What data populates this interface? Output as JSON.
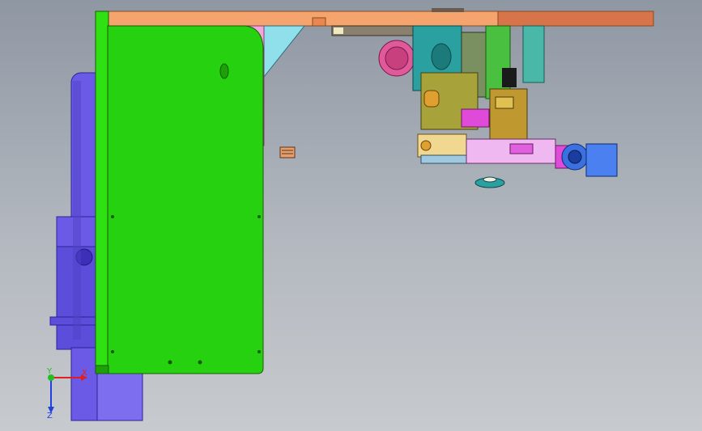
{
  "viewport": {
    "background_top": "#8f97a3",
    "background_bottom": "#c7cace"
  },
  "colors": {
    "plate_green": "#26d20f",
    "plate_outline": "#1a5a0a",
    "top_beam": "#f4a46c",
    "top_beam_dark": "#d8744a",
    "motor_blue": "#6a5ae6",
    "motor_dark": "#3d2fb8",
    "bracket_cyan": "#8fe0ea",
    "bracket_pink": "#f0a8d8",
    "gear_pink": "#e05a9a",
    "assy_olive": "#a8a23a",
    "assy_teal": "#2aa0a0",
    "assy_magenta": "#e04ad8",
    "assy_yellow": "#e0b040"
  },
  "triad": {
    "x_label": "X",
    "y_label": "Y",
    "z_label": "Z",
    "x_color": "#e02020",
    "y_color": "#20c020",
    "z_color": "#2040e0"
  }
}
